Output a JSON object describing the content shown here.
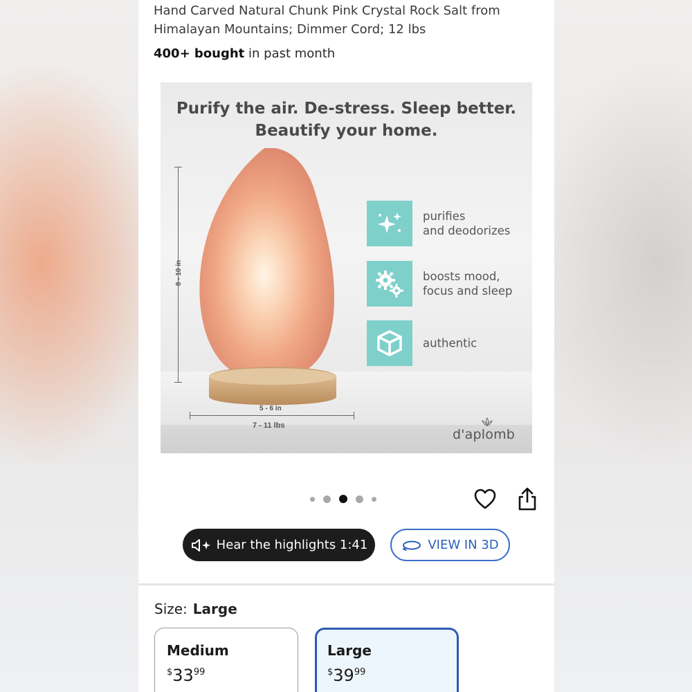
{
  "product": {
    "title_line1": "Hand Carved Natural Chunk Pink Crystal Rock Salt from",
    "title_line2": "Himalayan Mountains; Dimmer Cord; 12 lbs",
    "bought_bold": "400+ bought",
    "bought_rest": " in past month"
  },
  "image": {
    "headline_line1": "Purify the air. De-stress. Sleep better.",
    "headline_line2": "Beautify your home.",
    "height_label": "8 - 10 in",
    "width_label": "5 - 6 in",
    "weight_label": "7 - 11 lbs",
    "features": [
      {
        "icon": "sparkles-icon",
        "line1": "purifies",
        "line2": "and deodorizes"
      },
      {
        "icon": "gears-icon",
        "line1": "boosts mood,",
        "line2": "focus and sleep"
      },
      {
        "icon": "cube-icon",
        "line1": "authentic",
        "line2": ""
      }
    ],
    "brand": "d'aplomb",
    "feature_color": "#7fcfcb"
  },
  "carousel": {
    "dot_count": 5,
    "active_index": 2
  },
  "actions": {
    "hear_label": "Hear the highlights 1:41",
    "view3d_label": "VIEW IN 3D"
  },
  "size": {
    "label": "Size:",
    "selected": "Large",
    "options": [
      {
        "name": "Medium",
        "currency": "$",
        "whole": "33",
        "cents": "99",
        "selected": false
      },
      {
        "name": "Large",
        "currency": "$",
        "whole": "39",
        "cents": "99",
        "selected": true
      }
    ]
  },
  "colors": {
    "accent_blue": "#2c5bb0",
    "dark_button": "#1c1c1c"
  }
}
